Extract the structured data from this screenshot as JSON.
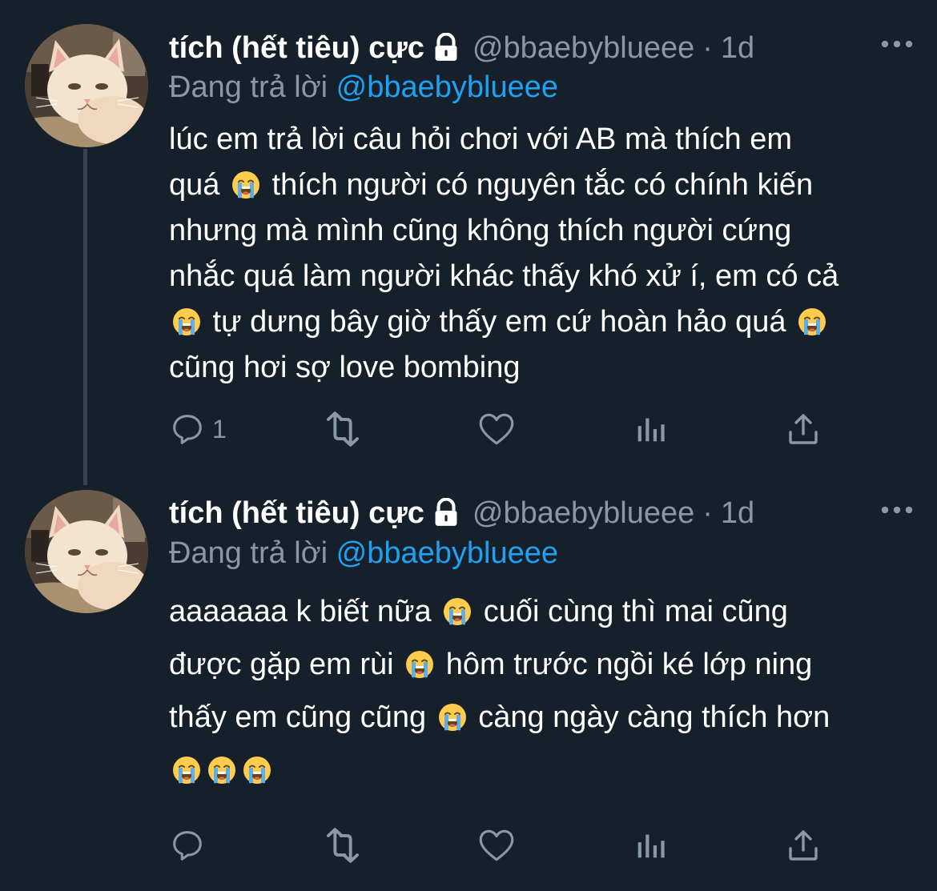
{
  "tweets": [
    {
      "display_name": "tích (hết tiêu) cực",
      "handle": "@bbaebyblueee",
      "separator": "·",
      "time": "1d",
      "reply_prefix": "Đang trả lời",
      "reply_handle": "@bbaebyblueee",
      "lines": [
        [
          "lúc em trả lời câu hỏi chơi với AB mà thích em"
        ],
        [
          "quá ",
          "EMOJI",
          " thích người có nguyên tắc có chính kiến"
        ],
        [
          "nhưng mà mình cũng không thích người cứng"
        ],
        [
          "nhắc quá làm người khác thấy khó xử í, em có cả"
        ],
        [
          "EMOJI",
          " tự dưng bây giờ thấy em cứ hoàn hảo quá ",
          "EMOJI"
        ],
        [
          "cũng hơi sợ love bombing"
        ]
      ],
      "actions": {
        "reply_count": "1",
        "retweet_count": "",
        "like_count": ""
      }
    },
    {
      "display_name": "tích (hết tiêu) cực",
      "handle": "@bbaebyblueee",
      "separator": "·",
      "time": "1d",
      "reply_prefix": "Đang trả lời",
      "reply_handle": "@bbaebyblueee",
      "lines": [
        [
          "aaaaaaa k biết nữa ",
          "EMOJI",
          " cuối cùng thì mai cũng"
        ],
        [
          "được gặp em rùi ",
          "EMOJI",
          " hôm trước ngồi ké lớp ning"
        ],
        [
          "thấy em cũng cũng ",
          "EMOJI",
          " càng ngày càng thích hơn"
        ],
        [
          "EMOJI",
          "EMOJI",
          "EMOJI"
        ]
      ],
      "actions": {
        "reply_count": "",
        "retweet_count": "",
        "like_count": ""
      }
    }
  ],
  "emoji_name": "loudly-crying-face",
  "colors": {
    "background": "#15202b",
    "secondary_text": "#8899a6",
    "link": "#1da1f2",
    "thread_line": "#38444d"
  }
}
